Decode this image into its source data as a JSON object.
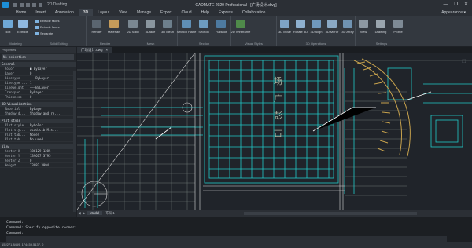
{
  "titlebar": {
    "workspace": "2D Drafting",
    "title": "CADMATE 2020 Professional - [广场设计.dwg]",
    "controls": [
      "—",
      "❐",
      "✕"
    ]
  },
  "menu": {
    "items": [
      "Home",
      "Insert",
      "Annotation",
      "3D",
      "Layout",
      "View",
      "Manage",
      "Export",
      "Cloud",
      "Help",
      "Express",
      "Collaboration"
    ],
    "active_index": 3,
    "appearance": "Appearance ▾"
  },
  "ribbon": {
    "groups": [
      {
        "label": "Modeling",
        "buttons": [
          "Box",
          "Extrude"
        ]
      },
      {
        "label": "Solid Editing",
        "small": [
          "Extrude faces",
          "Extrude faces",
          "Separate"
        ]
      },
      {
        "label": "Render",
        "buttons": [
          "Render",
          "Materials"
        ]
      },
      {
        "label": "Mesh",
        "buttons": [
          "2D Solid",
          "3Dface",
          "3D Mesh"
        ]
      },
      {
        "label": "Section",
        "buttons": [
          "Section Plane",
          "Section",
          "Flatshot"
        ]
      },
      {
        "label": "Visual Styles",
        "buttons": [
          "2D Wireframe"
        ]
      },
      {
        "label": "3D Operations",
        "buttons": [
          "3D Move",
          "Rotate 3D",
          "3D Align",
          "3D Mirror",
          "3D Array"
        ]
      },
      {
        "label": "Settings",
        "buttons": [
          "View",
          "Drawing",
          "Profile"
        ]
      }
    ]
  },
  "properties": {
    "title": "Properties",
    "selection": "No selection",
    "sections": [
      {
        "name": "General",
        "rows": [
          [
            "Color",
            "■ ByLayer"
          ],
          [
            "Layer",
            "0"
          ],
          [
            "Linetype",
            "———ByLayer"
          ],
          [
            "Linetype ...",
            "1"
          ],
          [
            "Lineweight",
            "———ByLayer"
          ],
          [
            "Transpar...",
            "ByLayer"
          ],
          [
            "Thickness",
            "0"
          ]
        ]
      },
      {
        "name": "3D Visualization",
        "rows": [
          [
            "Material",
            "ByLayer"
          ],
          [
            "Shadow d...",
            "Shadow and re..."
          ]
        ]
      },
      {
        "name": "Plot style",
        "rows": [
          [
            "Plot style",
            "ByColor"
          ],
          [
            "Plot sty...",
            "acad.ctb(Mis..."
          ],
          [
            "Plot tab...",
            "Model"
          ],
          [
            "Plot tab...",
            "No used"
          ]
        ]
      },
      {
        "name": "View",
        "rows": [
          [
            "Center X",
            "186129.1285"
          ],
          [
            "Center Y",
            "139617.3795"
          ],
          [
            "Center Z",
            "0"
          ],
          [
            "Height",
            "73082.3094"
          ]
        ]
      }
    ]
  },
  "document": {
    "tab": "广场设计.dwg",
    "close": "×"
  },
  "drawing_labels": {
    "char1": "场",
    "char2": "广",
    "char3": "彭",
    "char4": "古"
  },
  "layout_tabs": {
    "items": [
      "Model",
      "布局1"
    ],
    "active_index": 0
  },
  "command": {
    "lines": [
      "Command:",
      "Command: Specify opposite corner:",
      "Command:"
    ]
  },
  "status": {
    "coords": "152271.8469, 174459.5137, 0"
  },
  "colors": {
    "cyan": "#21c8c8",
    "dim": "#aab4a0",
    "accent": "#1d8fd8"
  }
}
